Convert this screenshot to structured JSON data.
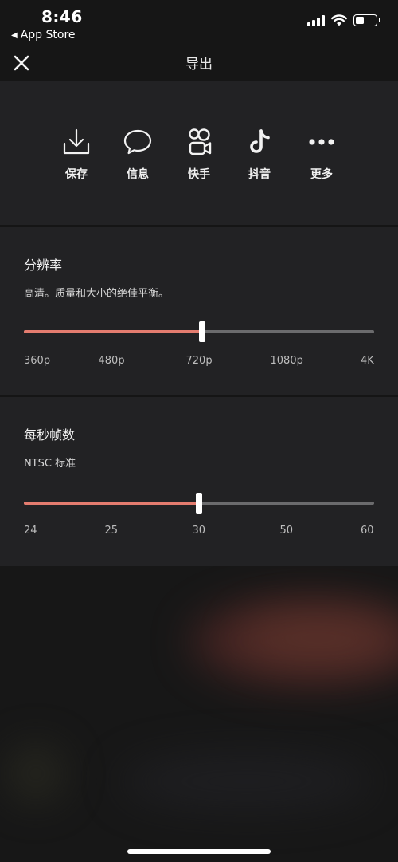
{
  "status_bar": {
    "time": "8:46",
    "back_label": "App Store",
    "back_arrow": "◀"
  },
  "nav": {
    "title": "导出",
    "close_icon": "close-icon"
  },
  "share": [
    {
      "icon": "download-icon",
      "label": "保存"
    },
    {
      "icon": "message-bubble-icon",
      "label": "信息"
    },
    {
      "icon": "kuaishou-icon",
      "label": "快手"
    },
    {
      "icon": "tiktok-icon",
      "label": "抖音"
    },
    {
      "icon": "more-dots-icon",
      "label": "更多"
    }
  ],
  "resolution": {
    "title": "分辨率",
    "description": "高清。质量和大小的绝佳平衡。",
    "options": [
      "360p",
      "480p",
      "720p",
      "1080p",
      "4K"
    ],
    "selected": "720p",
    "progress": 0.51
  },
  "framerate": {
    "title": "每秒帧数",
    "description": "NTSC 标准",
    "options": [
      "24",
      "25",
      "30",
      "50",
      "60"
    ],
    "selected": "30",
    "progress": 0.5
  },
  "colors": {
    "accent": "#e47c6f",
    "track": "#6b6b6d",
    "panel": "#222224",
    "background": "#151515"
  }
}
